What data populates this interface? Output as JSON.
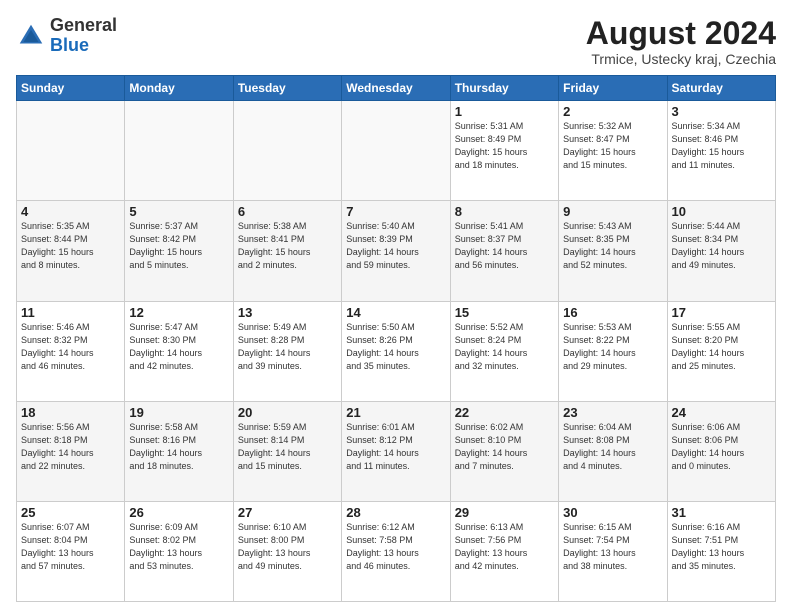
{
  "header": {
    "logo_general": "General",
    "logo_blue": "Blue",
    "title": "August 2024",
    "subtitle": "Trmice, Ustecky kraj, Czechia"
  },
  "weekdays": [
    "Sunday",
    "Monday",
    "Tuesday",
    "Wednesday",
    "Thursday",
    "Friday",
    "Saturday"
  ],
  "weeks": [
    [
      {
        "day": "",
        "info": ""
      },
      {
        "day": "",
        "info": ""
      },
      {
        "day": "",
        "info": ""
      },
      {
        "day": "",
        "info": ""
      },
      {
        "day": "1",
        "info": "Sunrise: 5:31 AM\nSunset: 8:49 PM\nDaylight: 15 hours\nand 18 minutes."
      },
      {
        "day": "2",
        "info": "Sunrise: 5:32 AM\nSunset: 8:47 PM\nDaylight: 15 hours\nand 15 minutes."
      },
      {
        "day": "3",
        "info": "Sunrise: 5:34 AM\nSunset: 8:46 PM\nDaylight: 15 hours\nand 11 minutes."
      }
    ],
    [
      {
        "day": "4",
        "info": "Sunrise: 5:35 AM\nSunset: 8:44 PM\nDaylight: 15 hours\nand 8 minutes."
      },
      {
        "day": "5",
        "info": "Sunrise: 5:37 AM\nSunset: 8:42 PM\nDaylight: 15 hours\nand 5 minutes."
      },
      {
        "day": "6",
        "info": "Sunrise: 5:38 AM\nSunset: 8:41 PM\nDaylight: 15 hours\nand 2 minutes."
      },
      {
        "day": "7",
        "info": "Sunrise: 5:40 AM\nSunset: 8:39 PM\nDaylight: 14 hours\nand 59 minutes."
      },
      {
        "day": "8",
        "info": "Sunrise: 5:41 AM\nSunset: 8:37 PM\nDaylight: 14 hours\nand 56 minutes."
      },
      {
        "day": "9",
        "info": "Sunrise: 5:43 AM\nSunset: 8:35 PM\nDaylight: 14 hours\nand 52 minutes."
      },
      {
        "day": "10",
        "info": "Sunrise: 5:44 AM\nSunset: 8:34 PM\nDaylight: 14 hours\nand 49 minutes."
      }
    ],
    [
      {
        "day": "11",
        "info": "Sunrise: 5:46 AM\nSunset: 8:32 PM\nDaylight: 14 hours\nand 46 minutes."
      },
      {
        "day": "12",
        "info": "Sunrise: 5:47 AM\nSunset: 8:30 PM\nDaylight: 14 hours\nand 42 minutes."
      },
      {
        "day": "13",
        "info": "Sunrise: 5:49 AM\nSunset: 8:28 PM\nDaylight: 14 hours\nand 39 minutes."
      },
      {
        "day": "14",
        "info": "Sunrise: 5:50 AM\nSunset: 8:26 PM\nDaylight: 14 hours\nand 35 minutes."
      },
      {
        "day": "15",
        "info": "Sunrise: 5:52 AM\nSunset: 8:24 PM\nDaylight: 14 hours\nand 32 minutes."
      },
      {
        "day": "16",
        "info": "Sunrise: 5:53 AM\nSunset: 8:22 PM\nDaylight: 14 hours\nand 29 minutes."
      },
      {
        "day": "17",
        "info": "Sunrise: 5:55 AM\nSunset: 8:20 PM\nDaylight: 14 hours\nand 25 minutes."
      }
    ],
    [
      {
        "day": "18",
        "info": "Sunrise: 5:56 AM\nSunset: 8:18 PM\nDaylight: 14 hours\nand 22 minutes."
      },
      {
        "day": "19",
        "info": "Sunrise: 5:58 AM\nSunset: 8:16 PM\nDaylight: 14 hours\nand 18 minutes."
      },
      {
        "day": "20",
        "info": "Sunrise: 5:59 AM\nSunset: 8:14 PM\nDaylight: 14 hours\nand 15 minutes."
      },
      {
        "day": "21",
        "info": "Sunrise: 6:01 AM\nSunset: 8:12 PM\nDaylight: 14 hours\nand 11 minutes."
      },
      {
        "day": "22",
        "info": "Sunrise: 6:02 AM\nSunset: 8:10 PM\nDaylight: 14 hours\nand 7 minutes."
      },
      {
        "day": "23",
        "info": "Sunrise: 6:04 AM\nSunset: 8:08 PM\nDaylight: 14 hours\nand 4 minutes."
      },
      {
        "day": "24",
        "info": "Sunrise: 6:06 AM\nSunset: 8:06 PM\nDaylight: 14 hours\nand 0 minutes."
      }
    ],
    [
      {
        "day": "25",
        "info": "Sunrise: 6:07 AM\nSunset: 8:04 PM\nDaylight: 13 hours\nand 57 minutes."
      },
      {
        "day": "26",
        "info": "Sunrise: 6:09 AM\nSunset: 8:02 PM\nDaylight: 13 hours\nand 53 minutes."
      },
      {
        "day": "27",
        "info": "Sunrise: 6:10 AM\nSunset: 8:00 PM\nDaylight: 13 hours\nand 49 minutes."
      },
      {
        "day": "28",
        "info": "Sunrise: 6:12 AM\nSunset: 7:58 PM\nDaylight: 13 hours\nand 46 minutes."
      },
      {
        "day": "29",
        "info": "Sunrise: 6:13 AM\nSunset: 7:56 PM\nDaylight: 13 hours\nand 42 minutes."
      },
      {
        "day": "30",
        "info": "Sunrise: 6:15 AM\nSunset: 7:54 PM\nDaylight: 13 hours\nand 38 minutes."
      },
      {
        "day": "31",
        "info": "Sunrise: 6:16 AM\nSunset: 7:51 PM\nDaylight: 13 hours\nand 35 minutes."
      }
    ]
  ]
}
